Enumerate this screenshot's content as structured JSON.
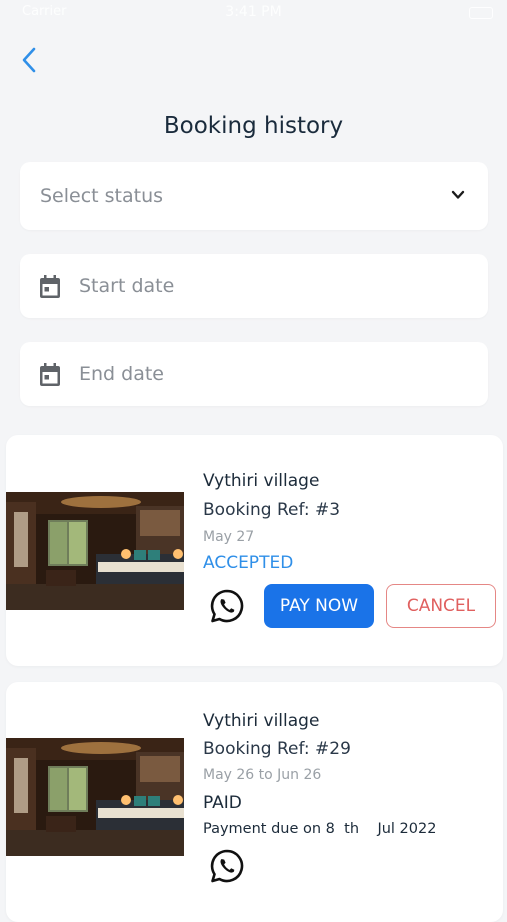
{
  "status_bar": {
    "left": "Carrier",
    "time": "3:41 PM"
  },
  "header": {
    "title": "Booking history",
    "back_icon": "chevron-left-icon"
  },
  "filters": {
    "status_placeholder": "Select status",
    "start_date_placeholder": "Start date",
    "end_date_placeholder": "End date"
  },
  "bookings": [
    {
      "hotel": "Vythiri village",
      "ref": "Booking Ref: #3",
      "dates": "May 27",
      "status": "ACCEPTED",
      "pay_label": "PAY NOW",
      "cancel_label": "CANCEL"
    },
    {
      "hotel": "Vythiri village",
      "ref": "Booking Ref: #29",
      "dates": "May 26 to Jun 26",
      "status": "PAID",
      "payment_due": "Payment due on 8  th    Jul 2022"
    }
  ],
  "colors": {
    "accent": "#1a73e8",
    "accepted": "#2f8fe8",
    "cancel": "#e0605f",
    "background": "#f4f5f7"
  }
}
